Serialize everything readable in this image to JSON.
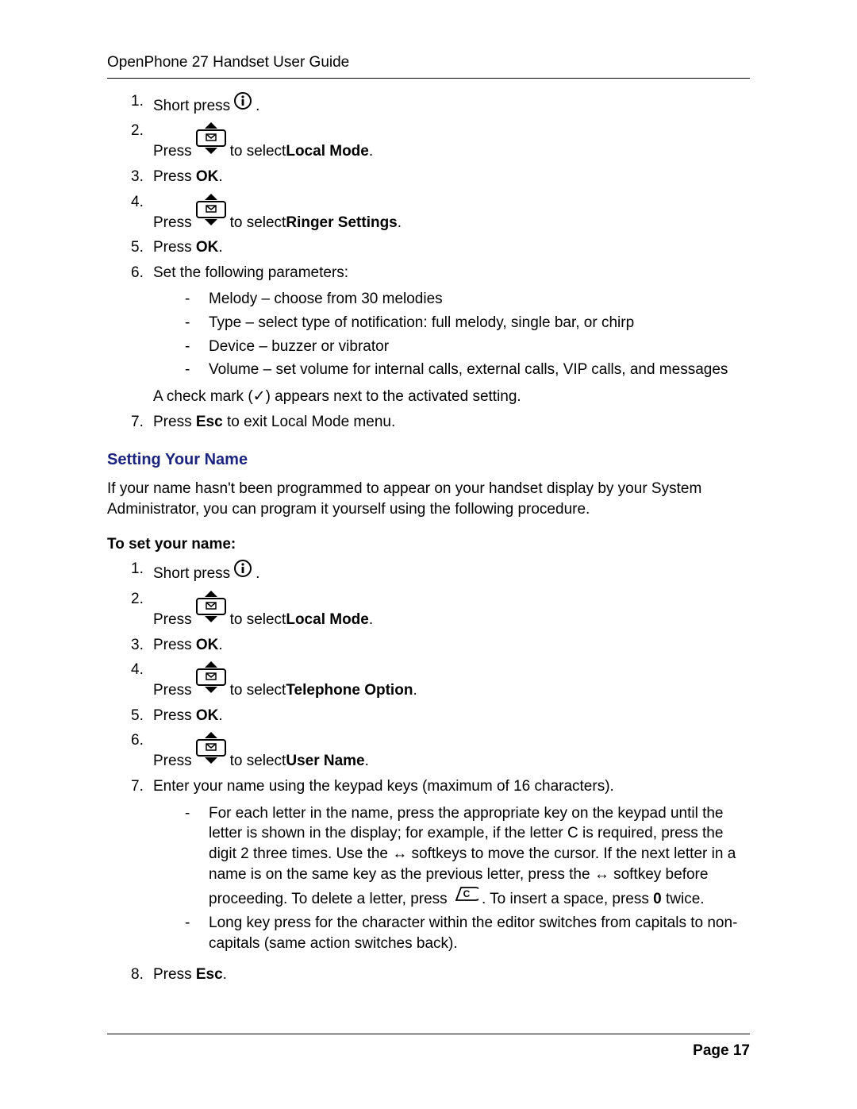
{
  "header": {
    "title": "OpenPhone 27 Handset User Guide"
  },
  "sec1": {
    "s1_pre": "Short press ",
    "s1_post": ".",
    "s2_pre": "Press ",
    "s2_mid": " to select ",
    "s2_bold": "Local Mode",
    "s2_post": ".",
    "s3a": "Press ",
    "s3b": "OK",
    "s3c": ".",
    "s4_pre": "Press ",
    "s4_mid": " to select ",
    "s4_bold": "Ringer Settings",
    "s4_post": ".",
    "s5a": "Press ",
    "s5b": "OK",
    "s5c": ".",
    "s6": "Set the following parameters:",
    "s6_a": "Melody – choose from 30 melodies",
    "s6_b": "Type – select type of notification: full melody, single bar, or chirp",
    "s6_c": "Device – buzzer or vibrator",
    "s6_d": "Volume – set volume for internal calls, external calls, VIP calls, and messages",
    "s6_after": "A check mark (✓) appears next to the activated setting.",
    "s7a": "Press ",
    "s7b": "Esc",
    "s7c": " to exit Local Mode menu."
  },
  "heading2": "Setting Your Name",
  "intro2": "If your name hasn't been programmed to appear on your handset display by your System Administrator, you can program it yourself using the following procedure.",
  "sub2": "To set your name:",
  "sec2": {
    "s1_pre": "Short press ",
    "s1_post": ".",
    "s2_pre": "Press ",
    "s2_mid": " to select ",
    "s2_bold": "Local Mode",
    "s2_post": ".",
    "s3a": "Press ",
    "s3b": "OK",
    "s3c": ".",
    "s4_pre": "Press ",
    "s4_mid": " to select ",
    "s4_bold": "Telephone Option",
    "s4_post": ".",
    "s5a": "Press ",
    "s5b": "OK",
    "s5c": ".",
    "s6_pre": "Press ",
    "s6_mid": " to select ",
    "s6_bold": "User Name",
    "s6_post": ".",
    "s7": "Enter your name using the keypad keys (maximum of 16 characters).",
    "s7a1": "For each letter in the name, press the appropriate key on the keypad until the letter is shown in the display; for example, if the letter C is required, press the digit 2 three times. Use the ",
    "s7a2": " softkeys to move the cursor. If the next letter in a name is on the same key as the previous letter, press the ",
    "s7a3": " softkey before proceeding. To delete a letter, press ",
    "s7a4": ". To insert a space, press ",
    "s7a5": "0",
    "s7a6": " twice.",
    "s7b": "Long key press for the character within the editor switches from capitals to non-capitals (same action switches back).",
    "s8a": "Press ",
    "s8b": "Esc",
    "s8c": "."
  },
  "footer": {
    "page": "Page 17"
  },
  "nums": [
    "1.",
    "2.",
    "3.",
    "4.",
    "5.",
    "6.",
    "7.",
    "8."
  ],
  "dash": "-",
  "arrows": "↔"
}
